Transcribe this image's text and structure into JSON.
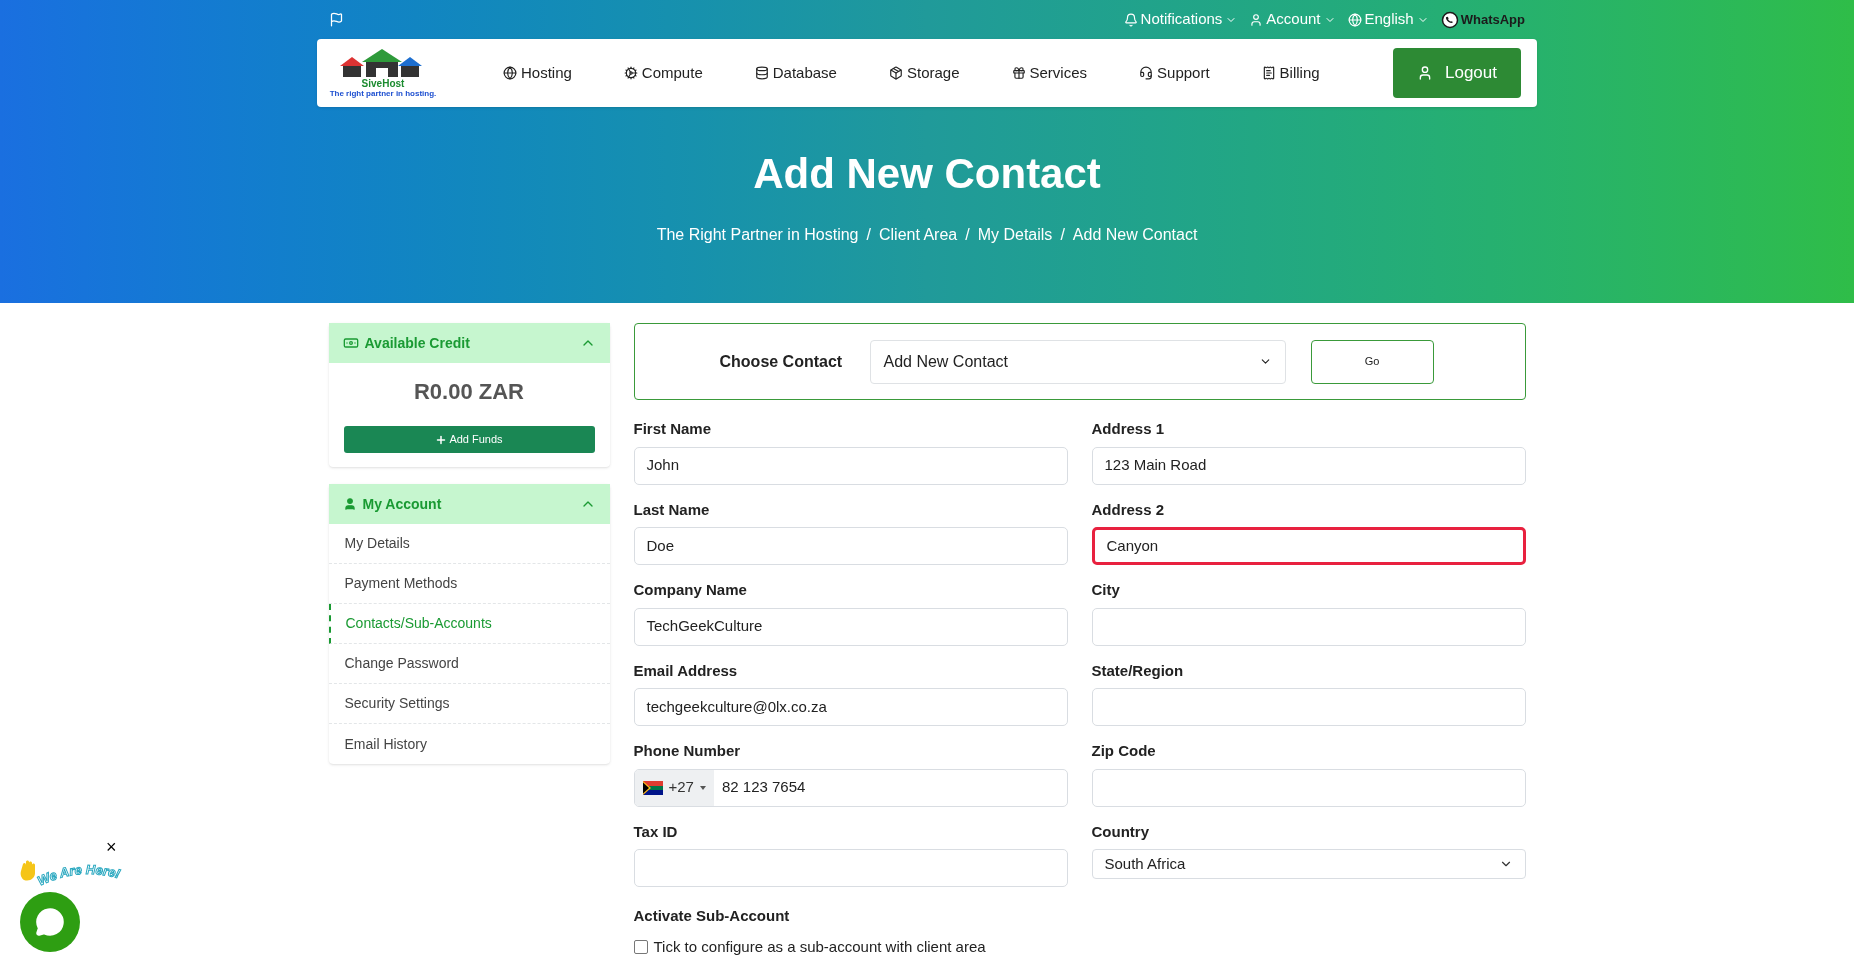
{
  "top_bar": {
    "links": [
      {
        "label": "Notifications"
      },
      {
        "label": "Account"
      },
      {
        "label": "English"
      }
    ],
    "whatsapp": "WhatsApp"
  },
  "logo": {
    "name": "SiveHost",
    "tagline": "The right partner in hosting."
  },
  "nav": [
    {
      "label": "Hosting"
    },
    {
      "label": "Compute"
    },
    {
      "label": "Database"
    },
    {
      "label": "Storage"
    },
    {
      "label": "Services"
    },
    {
      "label": "Support"
    },
    {
      "label": "Billing"
    }
  ],
  "logout": "Logout",
  "hero": {
    "title": "Add New Contact",
    "separator": "/",
    "breadcrumbs": [
      "The Right Partner in Hosting",
      "Client Area",
      "My Details",
      "Add New Contact"
    ]
  },
  "credit_panel": {
    "title": "Available Credit",
    "expanded": true,
    "amount": "R0.00 ZAR",
    "button": "Add Funds"
  },
  "account_panel": {
    "title": "My Account",
    "expanded": true,
    "items": [
      {
        "label": "My Details",
        "selected": false
      },
      {
        "label": "Payment Methods",
        "selected": false
      },
      {
        "label": "Contacts/Sub-Accounts",
        "selected": true
      },
      {
        "label": "Change Password",
        "selected": false
      },
      {
        "label": "Security Settings",
        "selected": false
      },
      {
        "label": "Email History",
        "selected": false
      }
    ]
  },
  "choose_contact": {
    "label": "Choose Contact",
    "value": "Add New Contact",
    "button": "Go"
  },
  "fields": [
    {
      "label": "First Name",
      "kind": "text",
      "value": "John",
      "highlighted": false
    },
    {
      "label": "Address 1",
      "kind": "text",
      "value": "123 Main Road",
      "highlighted": false
    },
    {
      "label": "Last Name",
      "kind": "text",
      "value": "Doe",
      "highlighted": false
    },
    {
      "label": "Address 2",
      "kind": "text",
      "value": "Canyon",
      "highlighted": true
    },
    {
      "label": "Company Name",
      "kind": "text",
      "value": "TechGeekCulture",
      "highlighted": false
    },
    {
      "label": "City",
      "kind": "text",
      "highlighted": false
    },
    {
      "label": "Email Address",
      "kind": "text",
      "value": "techgeekculture@0lx.co.za",
      "highlighted": false
    },
    {
      "label": "State/Region",
      "kind": "text",
      "highlighted": false
    },
    {
      "label": "Phone Number",
      "kind": "phone",
      "dial_code": "+27",
      "value": "82 123 7654",
      "highlighted": false
    },
    {
      "label": "Zip Code",
      "kind": "text",
      "highlighted": false
    },
    {
      "label": "Tax ID",
      "kind": "text",
      "highlighted": false
    },
    {
      "label": "Country",
      "kind": "select",
      "value": "South Africa",
      "highlighted": false
    }
  ],
  "sub_account": {
    "title": "Activate Sub-Account",
    "checked": false,
    "label": "Tick to configure as a sub-account with client area"
  },
  "chat_widget": {
    "caption": "We Are Here!",
    "close": "×"
  }
}
